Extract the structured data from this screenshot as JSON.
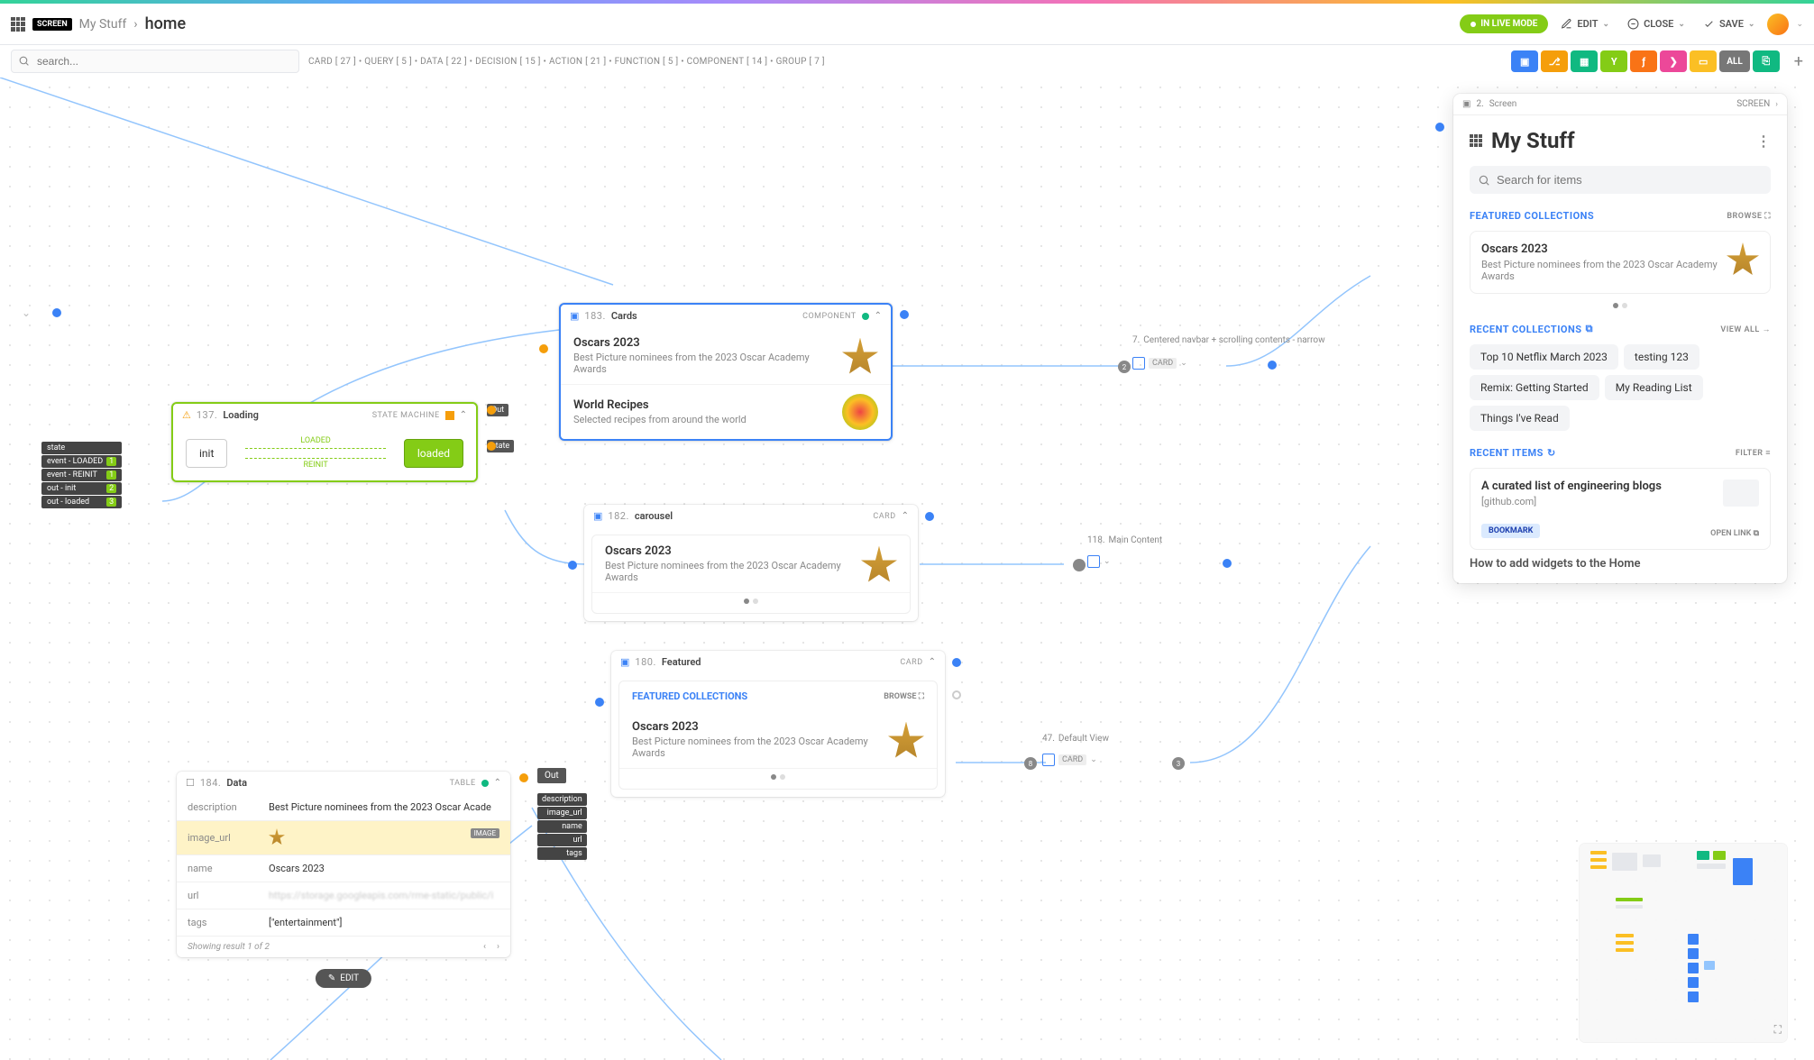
{
  "header": {
    "screen_badge": "SCREEN",
    "breadcrumb": "My Stuff",
    "page": "home",
    "live_mode": "IN LIVE MODE",
    "edit": "EDIT",
    "close": "CLOSE",
    "save": "SAVE"
  },
  "search_placeholder": "search...",
  "stats": "CARD [ 27 ] • QUERY [ 5 ] • DATA [ 22 ] • DECISION [ 15 ] • ACTION [ 21 ] • FUNCTION [ 5 ] • COMPONENT [ 14 ] • GROUP [ 7 ]",
  "toolbar_all": "ALL",
  "toolbar_colors": [
    "#3b82f6",
    "#f59e0b",
    "#10b981",
    "#84cc16",
    "#f97316",
    "#ec4899",
    "#fbbf24",
    "#6b7280"
  ],
  "nodes": {
    "loading": {
      "num": "137.",
      "title": "Loading",
      "type": "STATE MACHINE",
      "init": "init",
      "loaded": "loaded",
      "trans_loaded": "LOADED",
      "trans_reinit": "REINIT",
      "out": "Out",
      "state": "state",
      "labels": [
        {
          "t": "state",
          "n": ""
        },
        {
          "t": "event - LOADED",
          "n": "1"
        },
        {
          "t": "event - REINIT",
          "n": "1"
        },
        {
          "t": "out - init",
          "n": "2"
        },
        {
          "t": "out - loaded",
          "n": "3"
        }
      ]
    },
    "cards": {
      "num": "183.",
      "title": "Cards",
      "type": "COMPONENT",
      "items": [
        {
          "name": "Oscars 2023",
          "desc": "Best Picture nominees from the 2023 Oscar Academy Awards",
          "icon": "oscar"
        },
        {
          "name": "World Recipes",
          "desc": "Selected recipes from around the world",
          "icon": "recipe"
        }
      ]
    },
    "carousel": {
      "num": "182.",
      "title": "carousel",
      "type": "CARD",
      "item": {
        "name": "Oscars 2023",
        "desc": "Best Picture nominees from the 2023 Oscar Academy Awards"
      }
    },
    "featured": {
      "num": "180.",
      "title": "Featured",
      "type": "CARD",
      "section": "FEATURED COLLECTIONS",
      "browse": "BROWSE",
      "item": {
        "name": "Oscars 2023",
        "desc": "Best Picture nominees from the 2023 Oscar Academy Awards"
      }
    },
    "data": {
      "num": "184.",
      "title": "Data",
      "type": "TABLE",
      "rows": {
        "description": "Best Picture nominees from the 2023 Oscar Acade",
        "image_url_label": "image_url",
        "image_badge": "IMAGE",
        "name": "Oscars 2023",
        "url": "https://storage.googleapis.com/rme-static/public/i",
        "tags": "[\"entertainment\"]"
      },
      "footer": "Showing result 1 of 2",
      "edit": "EDIT",
      "out": "Out",
      "out_labels": [
        "description",
        "image_url",
        "name",
        "url",
        "tags"
      ]
    },
    "groups": {
      "centered": {
        "num": "7.",
        "title": "Centered navbar + scrolling contents - narrow",
        "type": "CARD"
      },
      "main_content": {
        "num": "118.",
        "title": "Main Content"
      },
      "default_view": {
        "num": "47.",
        "title": "Default View",
        "type": "CARD"
      }
    }
  },
  "preview": {
    "head_num": "2.",
    "head_title": "Screen",
    "head_type": "SCREEN",
    "title": "My Stuff",
    "search_ph": "Search for items",
    "sections": {
      "featured": {
        "label": "FEATURED COLLECTIONS",
        "action": "BROWSE"
      },
      "recent_coll": {
        "label": "RECENT COLLECTIONS",
        "action": "VIEW ALL"
      },
      "recent_items": {
        "label": "RECENT ITEMS",
        "action": "FILTER"
      }
    },
    "featured_card": {
      "name": "Oscars 2023",
      "desc": "Best Picture nominees from the 2023 Oscar Academy Awards"
    },
    "chips": [
      "Top 10 Netflix March 2023",
      "testing 123",
      "Remix: Getting Started",
      "My Reading List",
      "Things I've Read"
    ],
    "item": {
      "title": "A curated list of engineering blogs",
      "src": "[github.com]",
      "badge": "BOOKMARK",
      "open": "OPEN LINK"
    },
    "item2_title": "How to add widgets to the Home"
  }
}
